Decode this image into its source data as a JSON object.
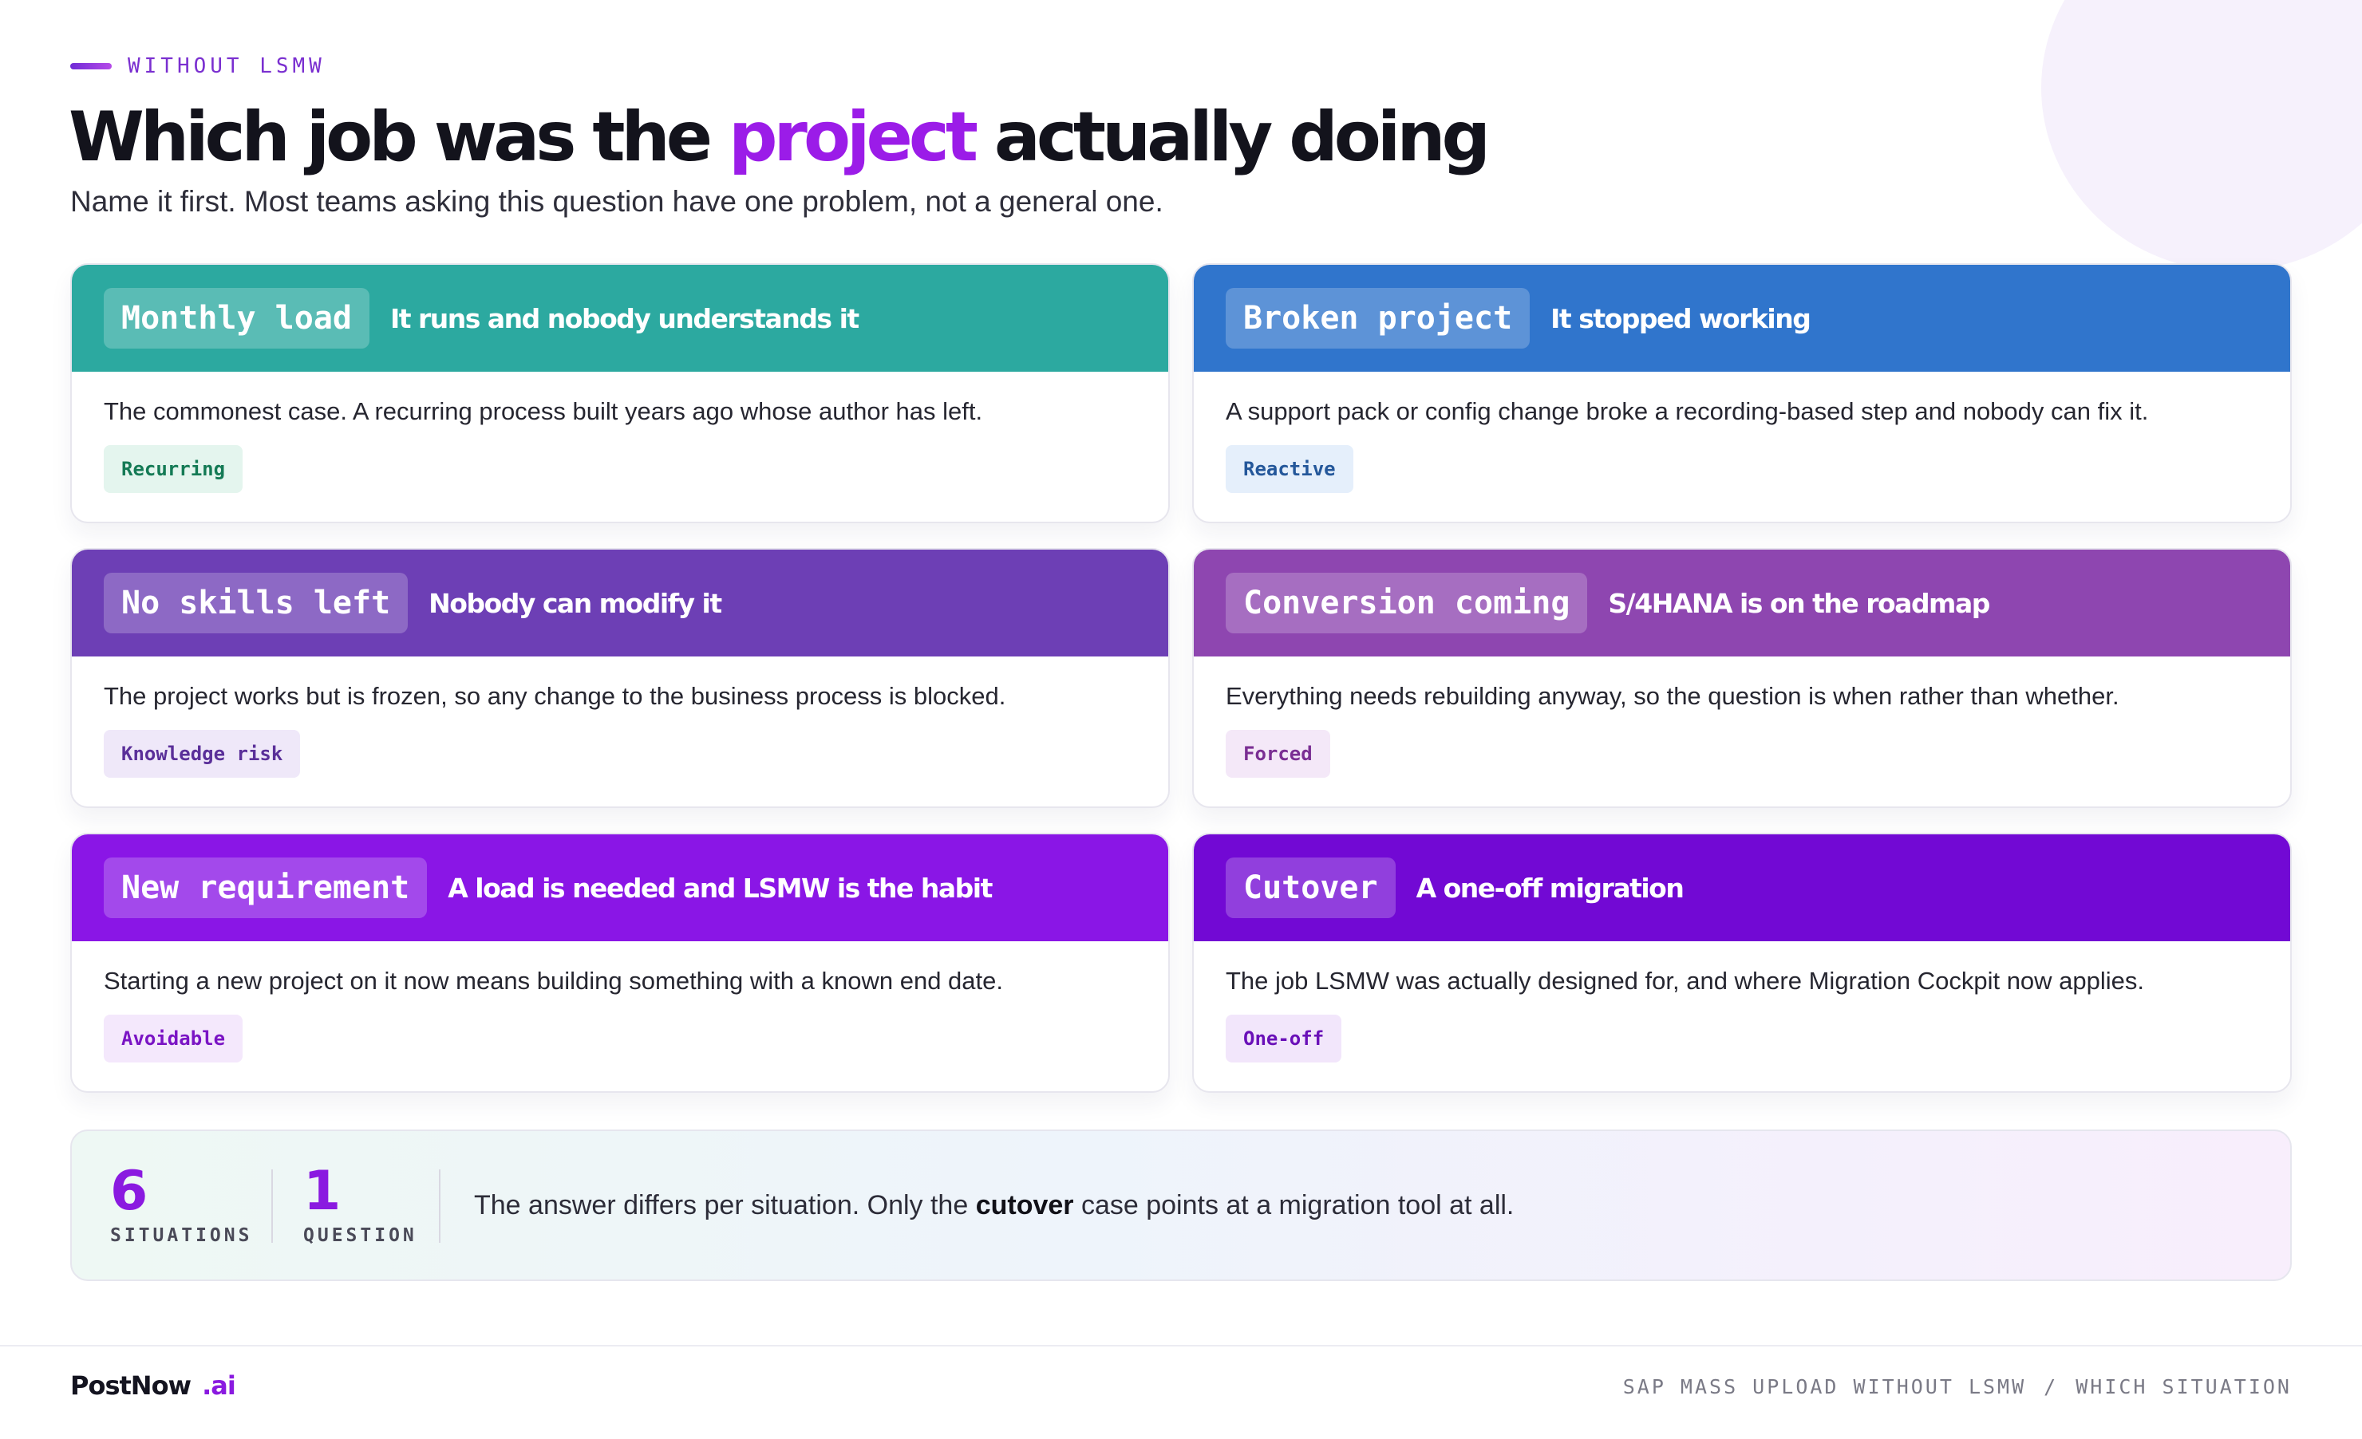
{
  "header": {
    "eyebrow": "WITHOUT LSMW",
    "title_before": "Which job was the ",
    "title_highlight": "project",
    "title_after": " actually doing",
    "subtitle": "Name it first. Most teams asking this question have one problem, not a general one."
  },
  "colors": {
    "accent": "#9b1ce8",
    "teal": "#2ca9a0",
    "blue": "#3075cc",
    "violet": "#6d3fb5",
    "plum": "#8e46b0",
    "purple": "#8a16e6",
    "deep_purple": "#7209d4"
  },
  "cards": [
    {
      "chip": "Monthly load",
      "title": "It runs and nobody understands it",
      "description": "The commonest case. A recurring process built years ago whose author has left.",
      "tag": "Recurring"
    },
    {
      "chip": "Broken project",
      "title": "It stopped working",
      "description": "A support pack or config change broke a recording-based step and nobody can fix it.",
      "tag": "Reactive"
    },
    {
      "chip": "No skills left",
      "title": "Nobody can modify it",
      "description": "The project works but is frozen, so any change to the business process is blocked.",
      "tag": "Knowledge risk"
    },
    {
      "chip": "Conversion coming",
      "title": "S/4HANA is on the roadmap",
      "description": "Everything needs rebuilding anyway, so the question is when rather than whether.",
      "tag": "Forced"
    },
    {
      "chip": "New requirement",
      "title": "A load is needed and LSMW is the habit",
      "description": "Starting a new project on it now means building something with a known end date.",
      "tag": "Avoidable"
    },
    {
      "chip": "Cutover",
      "title": "A one-off migration",
      "description": "The job LSMW was actually designed for, and where Migration Cockpit now applies.",
      "tag": "One-off"
    }
  ],
  "summary": {
    "stat1_value": "6",
    "stat1_label": "SITUATIONS",
    "stat2_value": "1",
    "stat2_label": "QUESTION",
    "text_before": "The answer differs per situation. Only the ",
    "text_bold": "cutover",
    "text_after": " case points at a migration tool at all."
  },
  "footer": {
    "brand": "PostNow",
    "brand_suffix": ".ai",
    "crumb1": "SAP MASS UPLOAD WITHOUT LSMW",
    "separator": "/",
    "crumb2": "WHICH SITUATION"
  }
}
